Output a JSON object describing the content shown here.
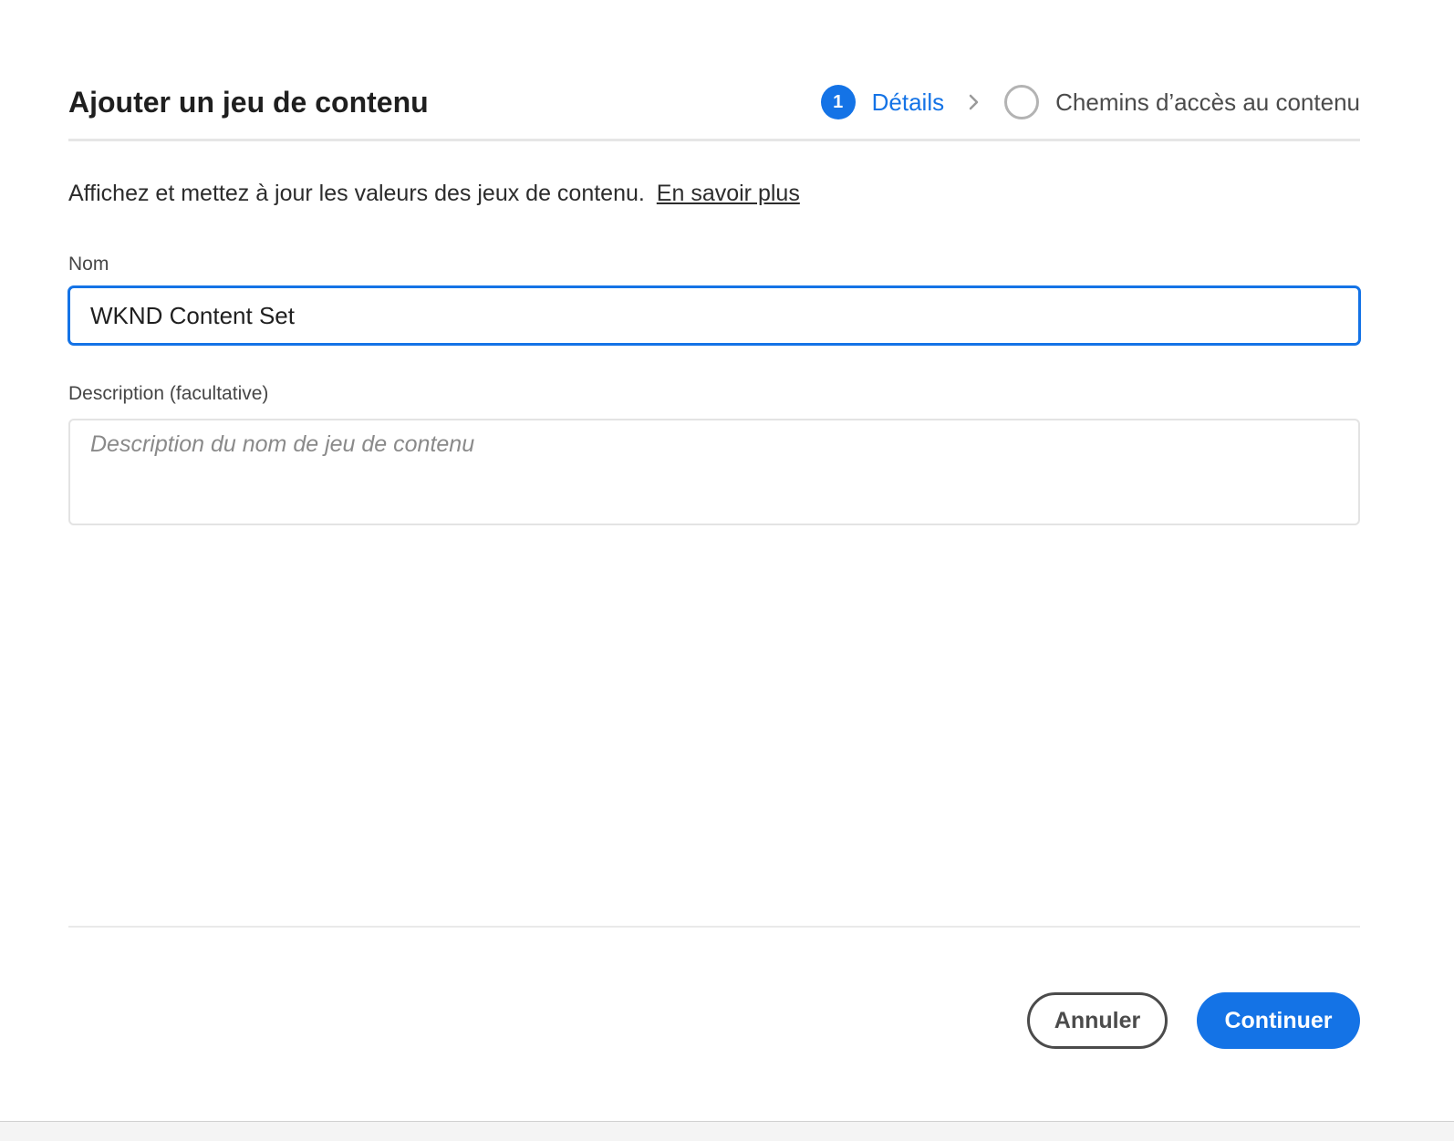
{
  "dialog": {
    "title": "Ajouter un jeu de contenu",
    "steps": [
      {
        "number": "1",
        "label": "Détails",
        "state": "active"
      },
      {
        "number": "",
        "label": "Chemins d’accès au contenu",
        "state": "inactive"
      }
    ],
    "intro": {
      "text": "Affichez et mettez à jour les valeurs des jeux de contenu.",
      "link_text": "En savoir plus"
    },
    "fields": {
      "name": {
        "label": "Nom",
        "value": "WKND Content Set"
      },
      "description": {
        "label": "Description (facultative)",
        "placeholder": "Description du nom de jeu de contenu",
        "value": ""
      }
    },
    "buttons": {
      "cancel_label": "Annuler",
      "continue_label": "Continuer"
    },
    "colors": {
      "accent": "#1473e6",
      "text": "#222222",
      "border": "#e3e3e3"
    },
    "icons": {
      "step_separator": "chevron-right-icon",
      "step_inactive": "empty-circle-icon"
    }
  }
}
